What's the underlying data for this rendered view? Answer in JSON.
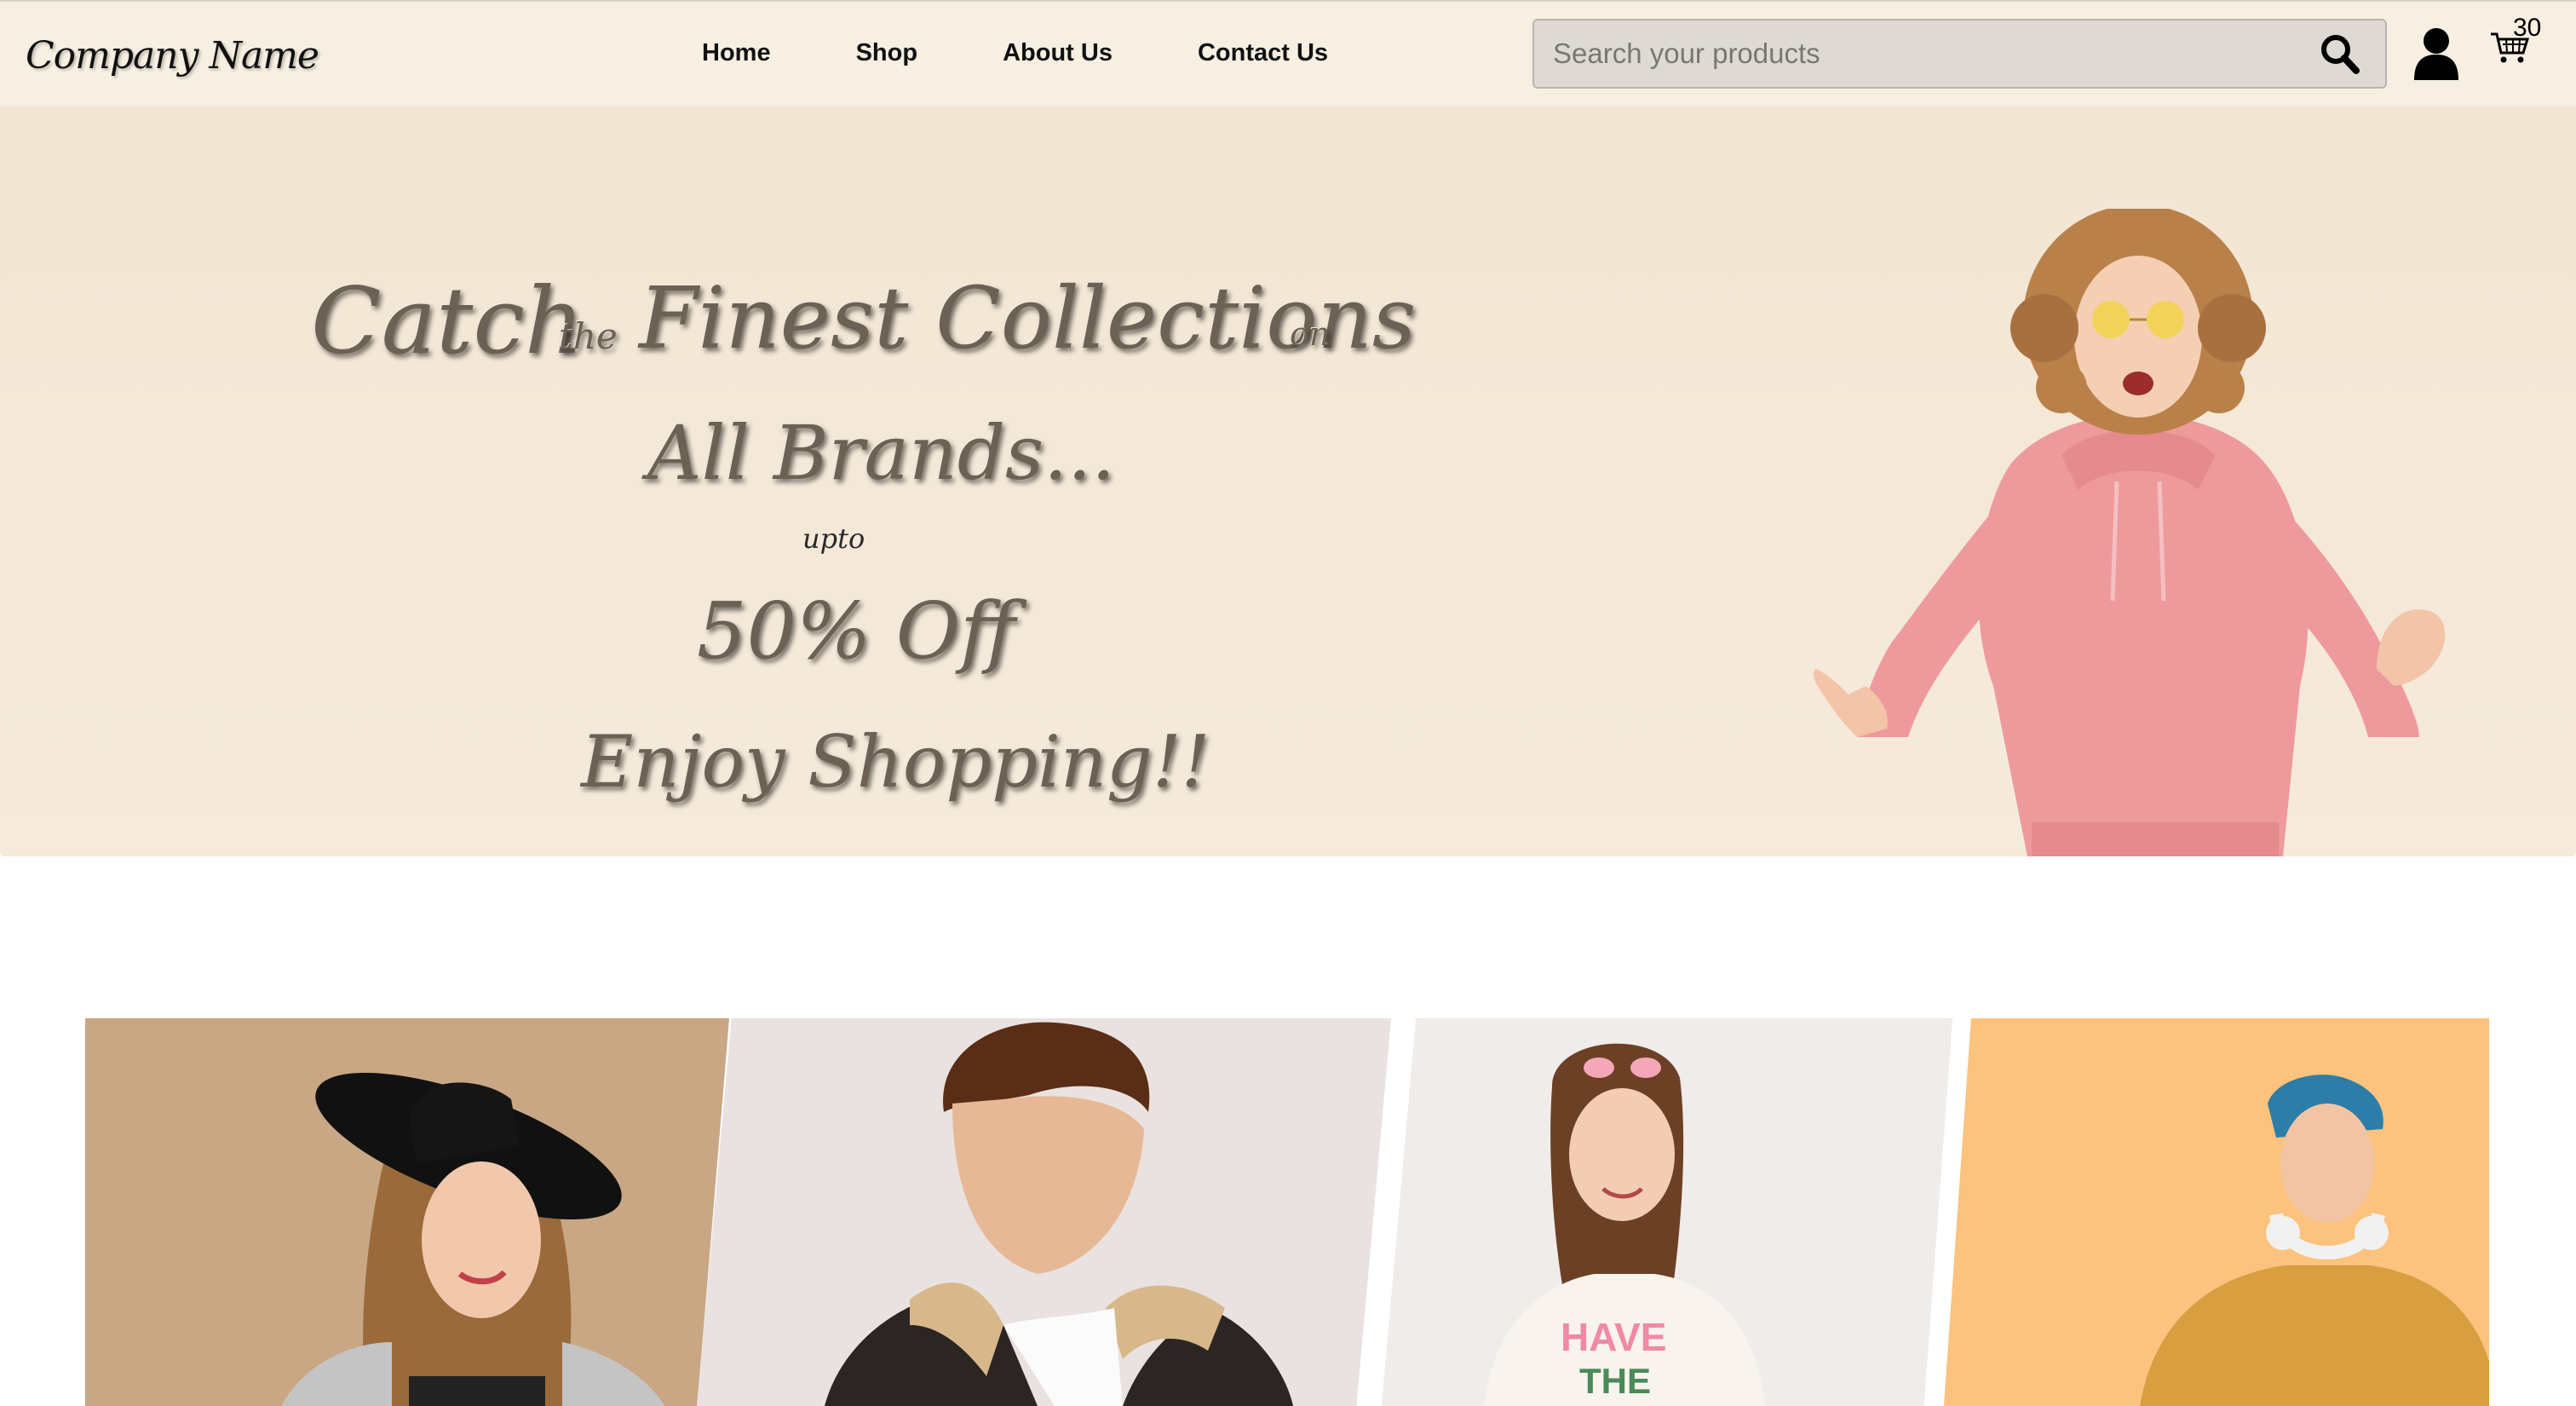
{
  "header": {
    "brand": "Company Name",
    "nav": [
      {
        "label": "Home"
      },
      {
        "label": "Shop"
      },
      {
        "label": "About Us"
      },
      {
        "label": "Contact Us"
      }
    ],
    "search": {
      "placeholder": "Search your products",
      "value": ""
    },
    "icons": {
      "search": "search-icon",
      "account": "user-icon",
      "cart": "cart-icon"
    },
    "cart_count": "30"
  },
  "hero": {
    "line1_a": "Catch",
    "line1_b": "the",
    "line1_c": "Finest Collections",
    "line1_d": "on",
    "line2": "All Brands...",
    "line3": "upto",
    "line4": "50% Off",
    "line5": "Enjoy Shopping!!"
  },
  "colors": {
    "navbar_bg": "#f6efe2",
    "hero_bg": "#f4e8d8",
    "hero_text": "#6d6156",
    "search_bg": "#dedad3"
  }
}
